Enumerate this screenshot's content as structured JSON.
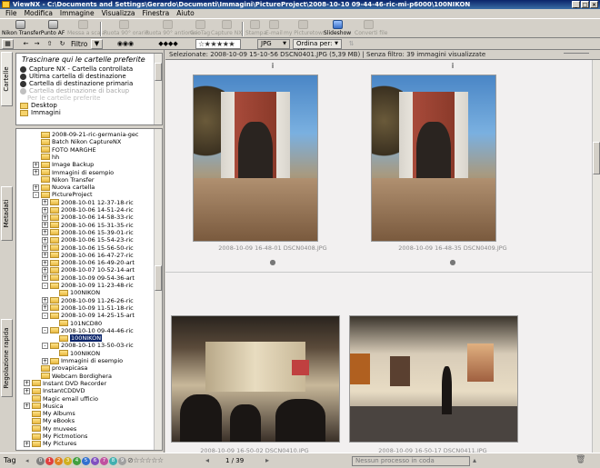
{
  "window": {
    "title": "ViewNX - C:\\Documents and Settings\\Gerardo\\Documenti\\Immagini\\PictureProject\\2008-10-10 09-44-46-ric-mi-p6000\\100NIKON"
  },
  "menu": [
    "File",
    "Modifica",
    "Immagine",
    "Visualizza",
    "Finestra",
    "Aiuto"
  ],
  "toolbar": {
    "buttons": [
      {
        "label": "Nikon Transfer",
        "enabled": true,
        "icon": "transfer-icon"
      },
      {
        "label": "Punto AF",
        "enabled": true,
        "icon": "af-point-icon"
      },
      {
        "label": "Messa a scala",
        "enabled": false,
        "icon": "scale-icon"
      },
      {
        "label": "Ruota 90° orario",
        "enabled": false,
        "icon": "rotate-cw-icon"
      },
      {
        "label": "Ruota 90° antiorario",
        "enabled": false,
        "icon": "rotate-ccw-icon"
      },
      {
        "label": "GeoTag",
        "enabled": false,
        "icon": "geotag-icon"
      },
      {
        "label": "Capture NX",
        "enabled": false,
        "icon": "capture-nx-icon"
      },
      {
        "label": "Stampa",
        "enabled": false,
        "icon": "print-icon"
      },
      {
        "label": "E-mail",
        "enabled": false,
        "icon": "email-icon"
      },
      {
        "label": "my Picturetown",
        "enabled": false,
        "icon": "picturetown-icon"
      },
      {
        "label": "Slideshow",
        "enabled": true,
        "icon": "slideshow-icon"
      },
      {
        "label": "Converti file",
        "enabled": false,
        "icon": "convert-icon"
      }
    ]
  },
  "filterbar": {
    "filter_label": "Filtro",
    "rating": "☆★★★★★",
    "format": "JPG",
    "sort": "Ordina per: Alfa"
  },
  "left_tabs": [
    "Cartelle",
    "Metadati",
    "Regolazione rapida"
  ],
  "favorites": {
    "header": "Trascinare qui le cartelle preferite",
    "items": [
      {
        "label": "Capture NX - Cartella controllata",
        "enabled": true
      },
      {
        "label": "Ultima cartella di destinazione",
        "enabled": true
      },
      {
        "label": "Cartella di destinazione primaria",
        "enabled": true
      },
      {
        "label": "Cartella destinazione di backup",
        "enabled": false
      }
    ],
    "hint": "Per le cartelle preferite",
    "folders": [
      "Desktop",
      "Immagini"
    ]
  },
  "tree": [
    {
      "label": "2008-09-21-ric-germania-gec",
      "depth": 4,
      "exp": ""
    },
    {
      "label": "Batch Nikon CaptureNX",
      "depth": 4,
      "exp": ""
    },
    {
      "label": "FOTO MARGHE",
      "depth": 4,
      "exp": ""
    },
    {
      "label": "hh",
      "depth": 4,
      "exp": ""
    },
    {
      "label": "Image Backup",
      "depth": 4,
      "exp": "+"
    },
    {
      "label": "Immagini di esempio",
      "depth": 4,
      "exp": "+"
    },
    {
      "label": "Nikon Transfer",
      "depth": 4,
      "exp": ""
    },
    {
      "label": "Nuova cartella",
      "depth": 4,
      "exp": "+"
    },
    {
      "label": "PictureProject",
      "depth": 4,
      "exp": "-"
    },
    {
      "label": "2008-10-01 12-37-18-ric",
      "depth": 5,
      "exp": "+"
    },
    {
      "label": "2008-10-06 14-51-24-ric",
      "depth": 5,
      "exp": "+"
    },
    {
      "label": "2008-10-06 14-58-33-ric",
      "depth": 5,
      "exp": "+"
    },
    {
      "label": "2008-10-06 15-31-35-ric",
      "depth": 5,
      "exp": "+"
    },
    {
      "label": "2008-10-06 15-39-01-ric",
      "depth": 5,
      "exp": "+"
    },
    {
      "label": "2008-10-06 15-54-23-ric",
      "depth": 5,
      "exp": "+"
    },
    {
      "label": "2008-10-06 15-56-50-ric",
      "depth": 5,
      "exp": "+"
    },
    {
      "label": "2008-10-06 16-47-27-ric",
      "depth": 5,
      "exp": "+"
    },
    {
      "label": "2008-10-06 16-49-20-art",
      "depth": 5,
      "exp": "+"
    },
    {
      "label": "2008-10-07 10-52-14-art",
      "depth": 5,
      "exp": "+"
    },
    {
      "label": "2008-10-09 09-54-36-art",
      "depth": 5,
      "exp": "+"
    },
    {
      "label": "2008-10-09 11-23-48-ric",
      "depth": 5,
      "exp": "-"
    },
    {
      "label": "100NIKON",
      "depth": 6,
      "exp": ""
    },
    {
      "label": "2008-10-09 11-26-26-ric",
      "depth": 5,
      "exp": "+"
    },
    {
      "label": "2008-10-09 11-51-18-ric",
      "depth": 5,
      "exp": "+"
    },
    {
      "label": "2008-10-09 14-25-15-art",
      "depth": 5,
      "exp": "-"
    },
    {
      "label": "101NCD80",
      "depth": 6,
      "exp": ""
    },
    {
      "label": "2008-10-10 09-44-46-ric",
      "depth": 5,
      "exp": "-"
    },
    {
      "label": "100NIKON",
      "depth": 6,
      "exp": "",
      "selected": true
    },
    {
      "label": "2008-10-10 13-50-03-ric",
      "depth": 5,
      "exp": "-"
    },
    {
      "label": "100NIKON",
      "depth": 6,
      "exp": ""
    },
    {
      "label": "Immagini di esempio",
      "depth": 5,
      "exp": "+"
    },
    {
      "label": "provapicasa",
      "depth": 4,
      "exp": ""
    },
    {
      "label": "Webcam Bordighera",
      "depth": 4,
      "exp": ""
    },
    {
      "label": "Instant DVD Recorder",
      "depth": 3,
      "exp": "+"
    },
    {
      "label": "InstantCDDVD",
      "depth": 3,
      "exp": "+"
    },
    {
      "label": "Magic email ufficio",
      "depth": 3,
      "exp": ""
    },
    {
      "label": "Musica",
      "depth": 3,
      "exp": "+"
    },
    {
      "label": "My Albums",
      "depth": 3,
      "exp": ""
    },
    {
      "label": "My eBooks",
      "depth": 3,
      "exp": ""
    },
    {
      "label": "My muvees",
      "depth": 3,
      "exp": ""
    },
    {
      "label": "My Pictmotions",
      "depth": 3,
      "exp": ""
    },
    {
      "label": "My Pictures",
      "depth": 3,
      "exp": "+"
    }
  ],
  "main": {
    "info": "Selezionate: 2008-10-09 15-10-56 DSCN0401.JPG (5,39 MB) | Senza filtro: 39 immagini visualizzate",
    "thumbs": [
      {
        "caption": "2008-10-09 16-48-01 DSCN0408.JPG"
      },
      {
        "caption": "2008-10-09 16-48-35 DSCN0409.JPG"
      },
      {
        "caption": "2008-10-09 16-50-02 DSCN0410.JPG"
      },
      {
        "caption": "2008-10-09 16-50-17 DSCN0411.JPG"
      }
    ]
  },
  "status": {
    "tag_label": "Tag",
    "page": "1 / 39",
    "process": "Nessun processo in coda"
  },
  "label_colors": [
    "#808080",
    "#e04040",
    "#e08020",
    "#d0b020",
    "#40a040",
    "#3070d0",
    "#8050c0",
    "#c050a0",
    "#40b0b0",
    "#a0a0a0"
  ]
}
